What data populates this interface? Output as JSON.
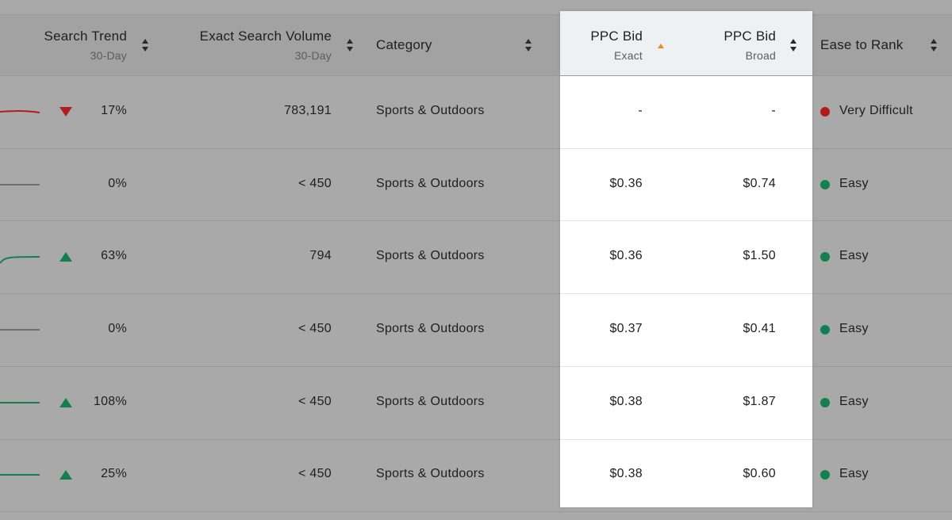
{
  "colors": {
    "down": "#b31c1c",
    "up": "#15804f",
    "flat": "#6f6f6f",
    "sort_active": "#e8892c",
    "sort_inactive": "#2a2a2a",
    "very_difficult": "#b31c1c",
    "easy": "#15804f"
  },
  "header": {
    "search_trend": {
      "label": "Search Trend",
      "sub": "30-Day",
      "icon": "sort-both-icon"
    },
    "exact_search_volume": {
      "label": "Exact Search Volume",
      "sub": "30-Day",
      "icon": "sort-both-icon"
    },
    "category": {
      "label": "Category",
      "icon": "sort-both-icon"
    },
    "ppc_bid_exact": {
      "label": "PPC Bid",
      "sub": "Exact",
      "icon": "sort-up-icon"
    },
    "ppc_bid_broad": {
      "label": "PPC Bid",
      "sub": "Broad",
      "icon": "sort-both-icon"
    },
    "ease_to_rank": {
      "label": "Ease to Rank",
      "icon": "sort-both-icon"
    }
  },
  "rows": [
    {
      "trend_direction": "down",
      "trend_pct": "17%",
      "volume": "783,191",
      "category": "Sports & Outdoors",
      "ppc_exact": "-",
      "ppc_broad": "-",
      "ease": "Very Difficult",
      "ease_level": "very_difficult"
    },
    {
      "trend_direction": "flat",
      "trend_pct": "0%",
      "volume": "< 450",
      "category": "Sports & Outdoors",
      "ppc_exact": "$0.36",
      "ppc_broad": "$0.74",
      "ease": "Easy",
      "ease_level": "easy"
    },
    {
      "trend_direction": "up",
      "trend_pct": "63%",
      "volume": "794",
      "category": "Sports & Outdoors",
      "ppc_exact": "$0.36",
      "ppc_broad": "$1.50",
      "ease": "Easy",
      "ease_level": "easy"
    },
    {
      "trend_direction": "flat",
      "trend_pct": "0%",
      "volume": "< 450",
      "category": "Sports & Outdoors",
      "ppc_exact": "$0.37",
      "ppc_broad": "$0.41",
      "ease": "Easy",
      "ease_level": "easy"
    },
    {
      "trend_direction": "up",
      "trend_pct": "108%",
      "volume": "< 450",
      "category": "Sports & Outdoors",
      "ppc_exact": "$0.38",
      "ppc_broad": "$1.87",
      "ease": "Easy",
      "ease_level": "easy"
    },
    {
      "trend_direction": "up",
      "trend_pct": "25%",
      "volume": "< 450",
      "category": "Sports & Outdoors",
      "ppc_exact": "$0.38",
      "ppc_broad": "$0.60",
      "ease": "Easy",
      "ease_level": "easy"
    }
  ]
}
